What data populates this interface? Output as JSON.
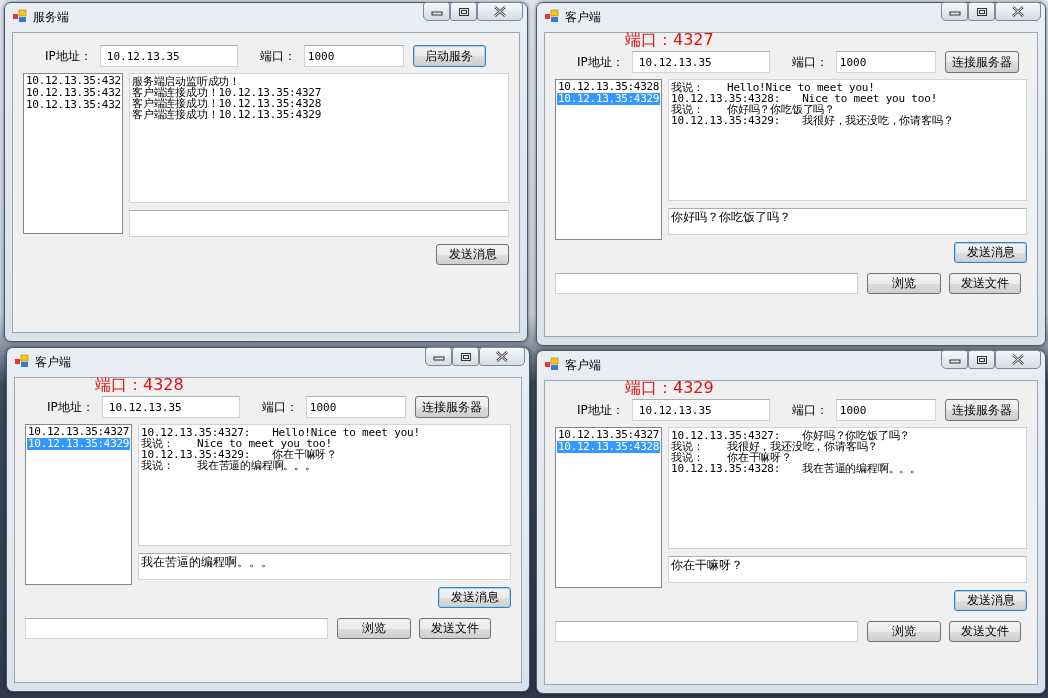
{
  "windows": [
    {
      "kind": "server",
      "title": "服务端",
      "ip_label": "IP地址：",
      "ip": "10.12.13.35",
      "port_label": "端口：",
      "port": "1000",
      "connect_button": {
        "label": "启动服务",
        "focused": true
      },
      "clients": [
        {
          "address": "10.12.13.35:432",
          "selected": false
        },
        {
          "address": "10.12.13.35:432",
          "selected": false
        },
        {
          "address": "10.12.13.35:432",
          "selected": false
        }
      ],
      "log": [
        {
          "text": "服务端启动监听成功！"
        },
        {
          "text": "客户端连接成功！10.12.13.35:4327"
        },
        {
          "text": "客户端连接成功！10.12.13.35:4328"
        },
        {
          "text": "客户端连接成功！10.12.13.35:4329"
        }
      ],
      "send_button": {
        "label": "发送消息",
        "focused": false
      }
    },
    {
      "kind": "client",
      "title": "客户端",
      "port_note": "端口：4327",
      "ip_label": "IP地址：",
      "ip": "10.12.13.35",
      "port_label": "端口：",
      "port": "1000",
      "connect_button": {
        "label": "连接服务器",
        "focused": false
      },
      "clients": [
        {
          "address": "10.12.13.35:4328",
          "selected": false
        },
        {
          "address": "10.12.13.35:4329",
          "selected": true
        }
      ],
      "log": [
        {
          "sender": "我说：",
          "message": "Hello!Nice to meet you!"
        },
        {
          "sender": "10.12.13.35:4328:",
          "message": "Nice to meet you too!"
        },
        {
          "sender": "我说：",
          "message": "你好吗？你吃饭了吗？"
        },
        {
          "sender": "10.12.13.35:4329:",
          "message": "我很好，我还没吃，你请客吗？"
        }
      ],
      "message": "你好吗？你吃饭了吗？",
      "send_button": {
        "label": "发送消息",
        "focused": true
      },
      "browse_button": "浏览",
      "send_file_button": "发送文件"
    },
    {
      "kind": "client",
      "title": "客户端",
      "port_note": "端口：4328",
      "ip_label": "IP地址：",
      "ip": "10.12.13.35",
      "port_label": "端口：",
      "port": "1000",
      "connect_button": {
        "label": "连接服务器",
        "focused": false
      },
      "clients": [
        {
          "address": "10.12.13.35:4327",
          "selected": false
        },
        {
          "address": "10.12.13.35:4329",
          "selected": true
        }
      ],
      "log": [
        {
          "sender": "10.12.13.35:4327:",
          "message": "Hello!Nice to meet you!"
        },
        {
          "sender": "我说：",
          "message": "Nice to meet you too!"
        },
        {
          "sender": "10.12.13.35:4329:",
          "message": "你在干嘛呀？"
        },
        {
          "sender": "我说：",
          "message": "我在苦逼的编程啊。。。"
        }
      ],
      "message": "我在苦逼的编程啊。。。",
      "send_button": {
        "label": "发送消息",
        "focused": true
      },
      "browse_button": "浏览",
      "send_file_button": "发送文件"
    },
    {
      "kind": "client",
      "title": "客户端",
      "port_note": "端口：4329",
      "ip_label": "IP地址：",
      "ip": "10.12.13.35",
      "port_label": "端口：",
      "port": "1000",
      "connect_button": {
        "label": "连接服务器",
        "focused": false
      },
      "clients": [
        {
          "address": "10.12.13.35:4327",
          "selected": false
        },
        {
          "address": "10.12.13.35:4328",
          "selected": true
        }
      ],
      "log": [
        {
          "sender": "10.12.13.35:4327:",
          "message": "你好吗？你吃饭了吗？"
        },
        {
          "sender": "我说：",
          "message": "我很好，我还没吃，你请客吗？"
        },
        {
          "sender": "我说：",
          "message": "你在干嘛呀？"
        },
        {
          "sender": "10.12.13.35:4328:",
          "message": "我在苦逼的编程啊。。。"
        }
      ],
      "message": "你在干嘛呀？",
      "send_button": {
        "label": "发送消息",
        "focused": true
      },
      "browse_button": "浏览",
      "send_file_button": "发送文件"
    }
  ]
}
